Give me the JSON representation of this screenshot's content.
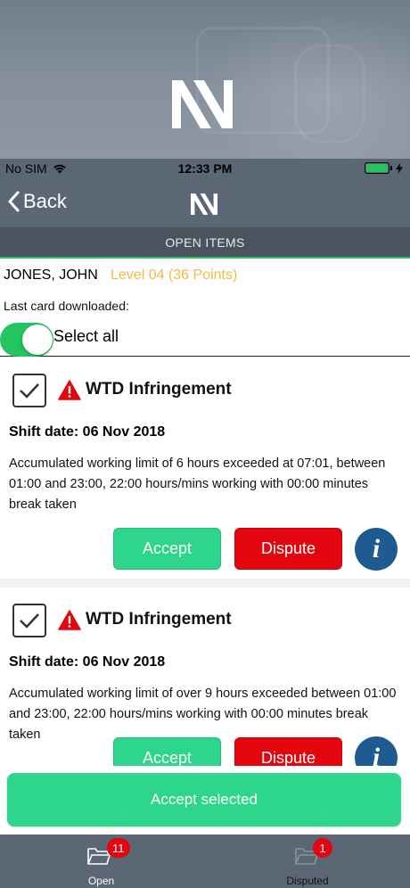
{
  "status_bar": {
    "carrier": "No SIM",
    "time": "12:33 PM"
  },
  "nav": {
    "back_label": "Back"
  },
  "section": {
    "title": "OPEN ITEMS"
  },
  "driver": {
    "name": "JONES, JOHN",
    "level": "Level 04 (36 Points)",
    "last_card_label": "Last card downloaded:",
    "select_all_label": "Select all",
    "select_all_on": true
  },
  "items": [
    {
      "checked": true,
      "title": "WTD Infringement",
      "shift_date": "Shift date: 06 Nov 2018",
      "description": "Accumulated working limit of 6 hours exceeded at 07:01, between 01:00 and 23:00, 22:00 hours/mins working with 00:00 minutes break taken",
      "accept_label": "Accept",
      "dispute_label": "Dispute",
      "info_label": "i"
    },
    {
      "checked": true,
      "title": "WTD Infringement",
      "shift_date": "Shift date: 06 Nov 2018",
      "description": "Accumulated working limit of over 9 hours exceeded between 01:00 and 23:00, 22:00 hours/mins working with 00:00 minutes break taken",
      "accept_label": "Accept",
      "dispute_label": "Dispute",
      "info_label": "i"
    }
  ],
  "accept_selected_label": "Accept selected",
  "tabs": [
    {
      "label": "Open",
      "badge": "11"
    },
    {
      "label": "Disputed",
      "badge": "1"
    }
  ],
  "colors": {
    "accent_green": "#2dd68a",
    "dispute_red": "#e3060f",
    "level_gold": "#f4b942",
    "info_blue": "#1f5a90",
    "bar_gray": "#5b6774"
  }
}
